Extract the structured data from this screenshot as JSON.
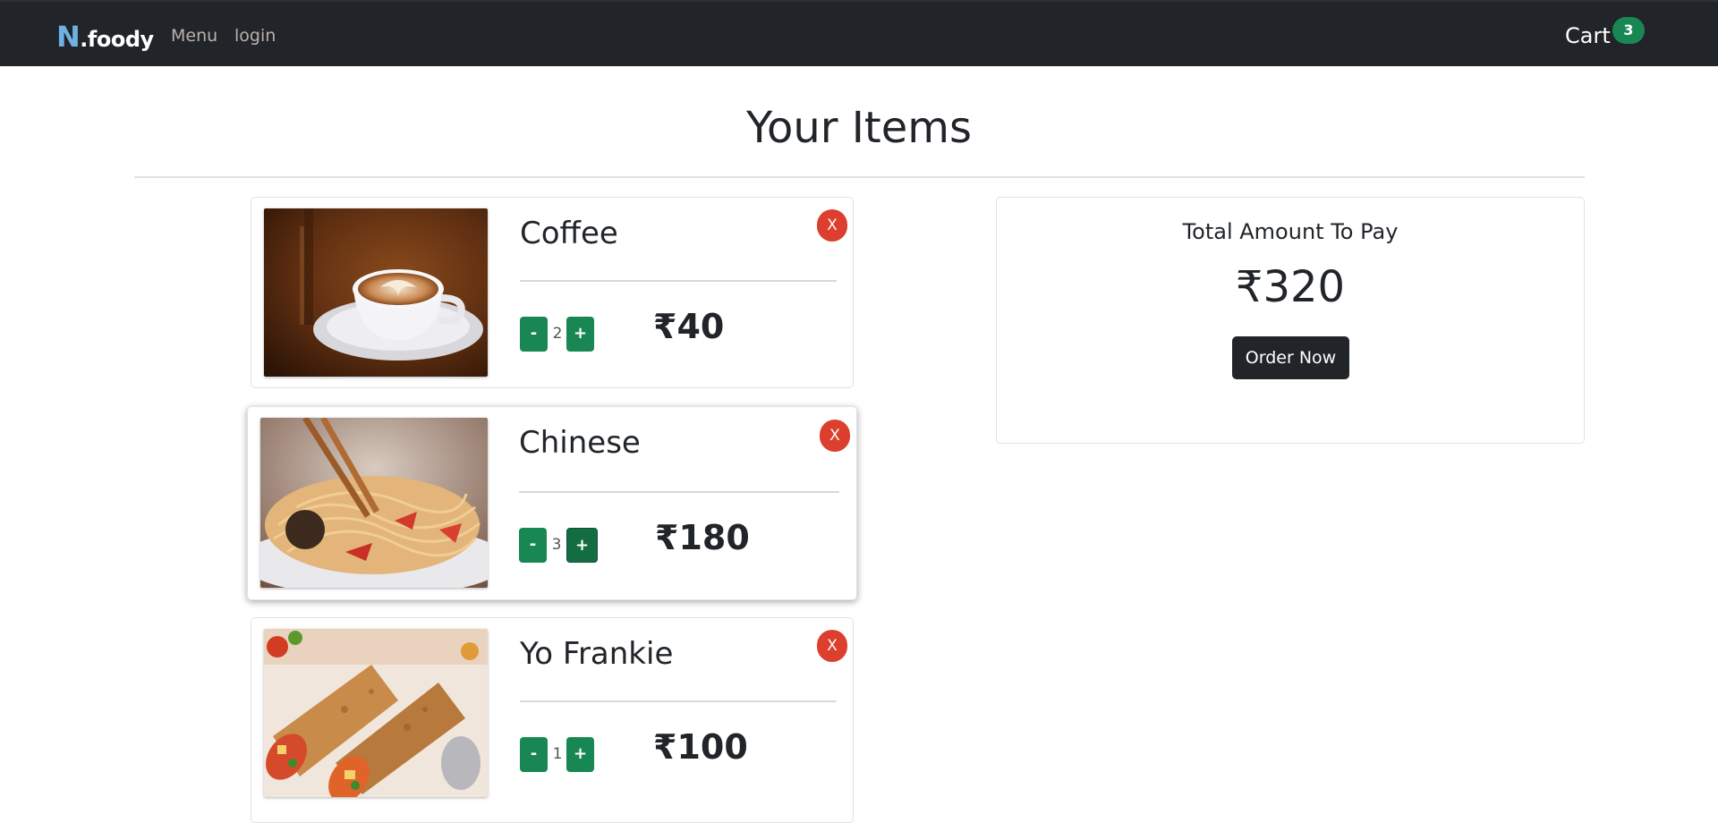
{
  "navbar": {
    "brand_initial": "N",
    "brand_rest": ".foody",
    "menu_label": "Menu",
    "login_label": "login",
    "cart_label": "Cart",
    "cart_count": "3"
  },
  "page": {
    "title": "Your Items"
  },
  "items": [
    {
      "name": "Coffee",
      "quantity": "2",
      "price": "₹40",
      "minus_label": "-",
      "plus_label": "+",
      "remove_label": "X",
      "image": "coffee-cup-image"
    },
    {
      "name": "Chinese",
      "quantity": "3",
      "price": "₹180",
      "minus_label": "-",
      "plus_label": "+",
      "remove_label": "X",
      "image": "noodles-plate-image"
    },
    {
      "name": "Yo Frankie",
      "quantity": "1",
      "price": "₹100",
      "minus_label": "-",
      "plus_label": "+",
      "remove_label": "X",
      "image": "frankie-wrap-image"
    }
  ],
  "summary": {
    "label": "Total Amount To Pay",
    "total": "₹320",
    "order_button": "Order Now"
  },
  "colors": {
    "navbar": "#212529",
    "accent_green": "#198754",
    "remove_red": "#dc3f2e",
    "brand_blue": "#6fb1e3"
  }
}
